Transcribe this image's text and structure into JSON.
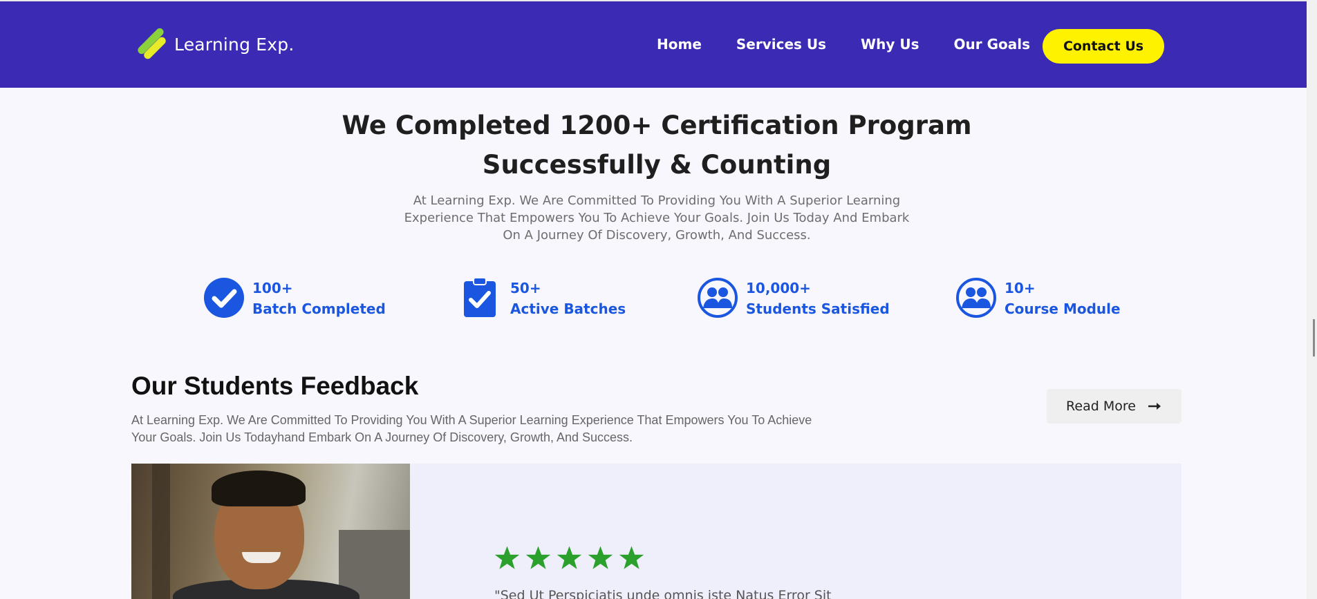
{
  "header": {
    "logo_text": "Learning Exp.",
    "nav": [
      "Home",
      "Services Us",
      "Why Us",
      "Our Goals"
    ],
    "contact_label": "Contact Us",
    "bg_color": "#3b2ab3",
    "accent_color": "#fff200"
  },
  "hero": {
    "title_line1": "We Completed 1200+ Certification Program",
    "title_line2": "Successfully & Counting",
    "subtitle": "At Learning Exp. We Are Committed To Providing You With A Superior Learning Experience That Empowers You To Achieve Your Goals. Join Us Today And Embark On A Journey Of Discovery, Growth, And Success."
  },
  "stats": [
    {
      "value": "100+",
      "label": "Batch Completed",
      "icon": "check-circle-icon"
    },
    {
      "value": "50+",
      "label": "Active Batches",
      "icon": "clipboard-check-icon"
    },
    {
      "value": "10,000+",
      "label": "Students Satisfied",
      "icon": "users-icon"
    },
    {
      "value": "10+",
      "label": "Course Module",
      "icon": "users-icon"
    }
  ],
  "feedback": {
    "title": "Our Students Feedback",
    "subtitle": "At Learning Exp. We Are Committed To Providing You With A Superior Learning Experience That Empowers You To Achieve Your Goals. Join Us Todayhand Embark On A Journey Of Discovery, Growth, And Success.",
    "read_more": "Read More",
    "rating": 5,
    "quote": "\"Sed Ut Perspiciatis unde omnis iste Natus Error Sit"
  }
}
